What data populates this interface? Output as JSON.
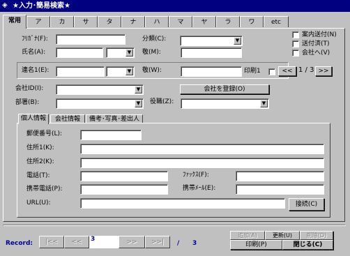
{
  "window": {
    "title": "★入力･簡易検索★"
  },
  "tabs": [
    "常用",
    "ア",
    "カ",
    "サ",
    "タ",
    "ナ",
    "ハ",
    "マ",
    "ヤ",
    "ラ",
    "ワ",
    "etc"
  ],
  "form": {
    "furigana_label": "ﾌﾘｶﾞﾅ(F):",
    "name_label": "氏名(A):",
    "bunrui_label": "分類(C):",
    "kei_label": "敬(M):",
    "check_sanka": "案内送付(N)",
    "check_sumi": "送付済(T)",
    "check_kaisha": "会社へ(V)",
    "renmei_label": "連名1(E):",
    "kei2_label": "敬(W):",
    "insatsu_label": "印刷1",
    "pager_prev": "<<",
    "pager_value": "1 / 3",
    "pager_next": ">>",
    "company_label": "会社ID(I):",
    "company_register": "会社を登録(O)",
    "dept_label": "部署(B):",
    "position_label": "役職(Z):"
  },
  "subtabs": [
    "個人情報",
    "会社情報",
    "備考･写真･差出人"
  ],
  "personal": {
    "zip_label": "郵便番号(L):",
    "address1_label": "住所1(K):",
    "address2_label": "住所2(K):",
    "tel_label": "電話(T):",
    "fax_label": "ﾌｧｯｸｽ(F):",
    "mobile_label": "携帯電話(P):",
    "mobile_mail_label": "携帯ﾒｰﾙ(E):",
    "url_label": "URL(U):",
    "browse_button": "接続(C)"
  },
  "footer": {
    "record_label": "Record:",
    "first": "|<<",
    "prev": "<<",
    "current": "3",
    "next": ">>",
    "last": ">>|",
    "separator": "/",
    "total": "3",
    "add": "追加(A)",
    "update": "更新(U)",
    "delete": "削除(D)",
    "print": "印刷(P)",
    "close": "閉じる(C)"
  }
}
